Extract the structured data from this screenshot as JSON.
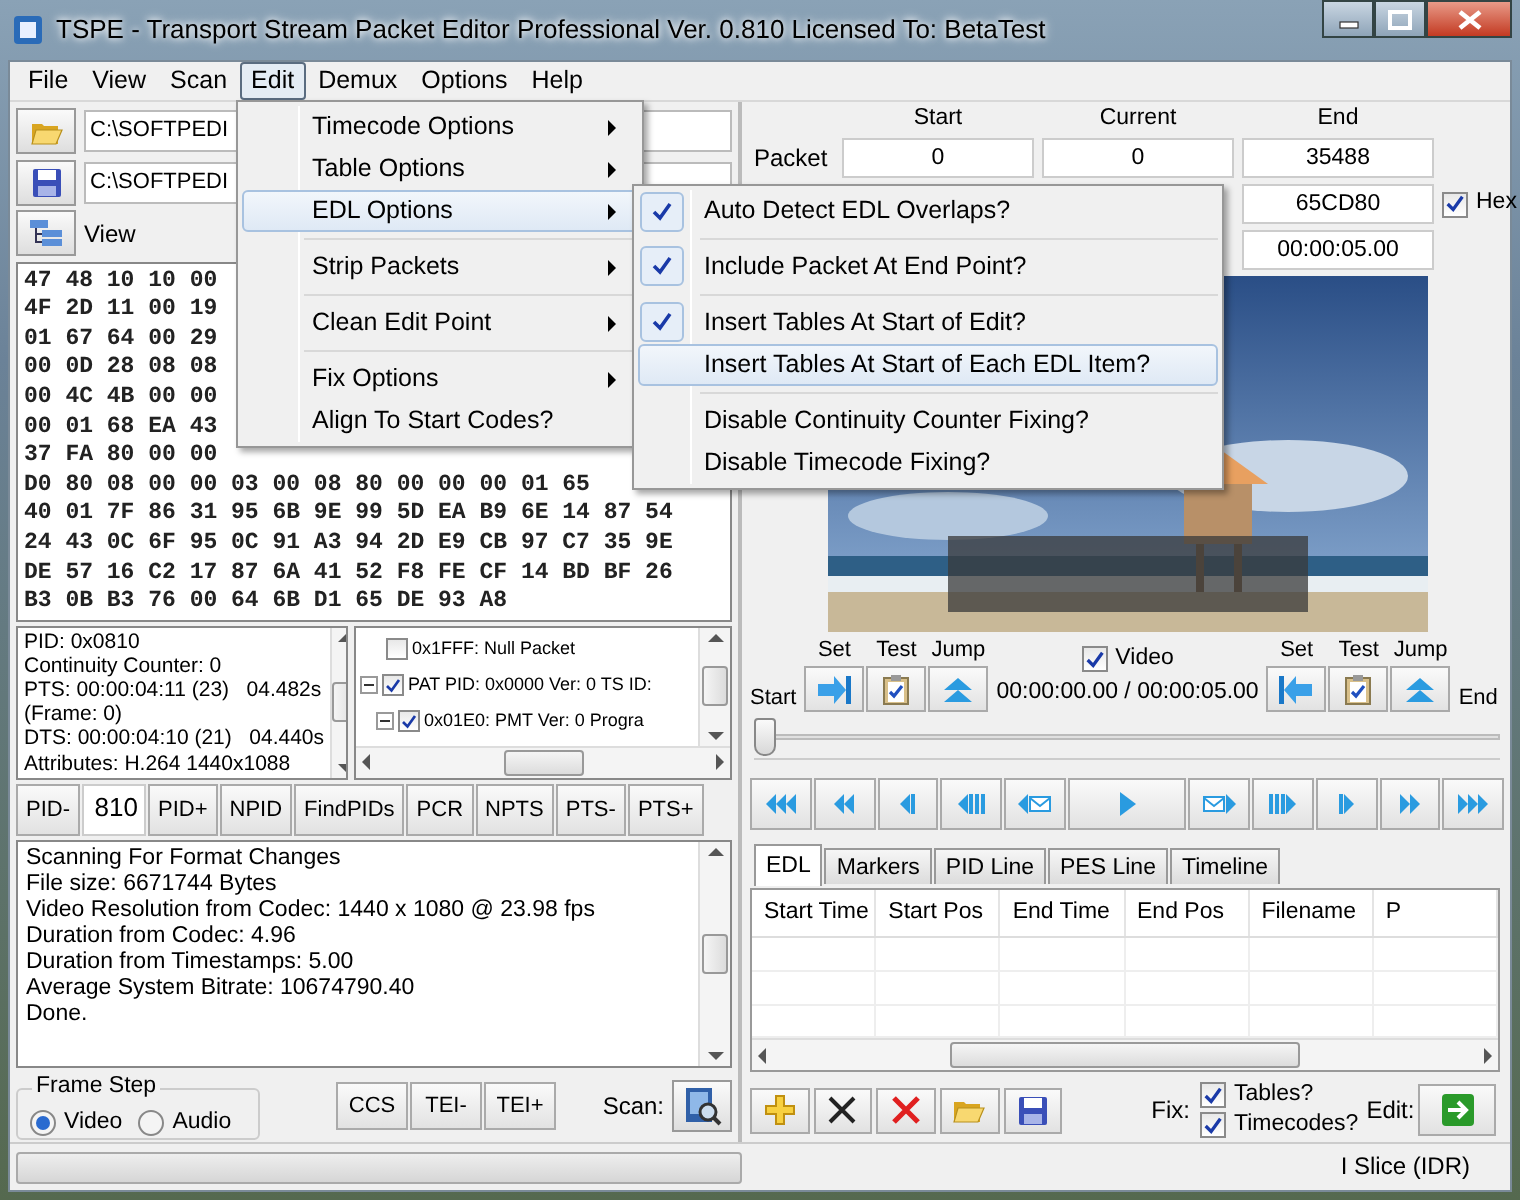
{
  "window": {
    "title": "TSPE - Transport Stream Packet Editor Professional Ver. 0.810 Licensed To: BetaTest"
  },
  "menu_bar": [
    {
      "label": "File",
      "selected": false
    },
    {
      "label": "View",
      "selected": false
    },
    {
      "label": "Scan",
      "selected": false
    },
    {
      "label": "Edit",
      "selected": true
    },
    {
      "label": "Demux",
      "selected": false
    },
    {
      "label": "Options",
      "selected": false
    },
    {
      "label": "Help",
      "selected": false
    }
  ],
  "edit_menu": [
    {
      "label": "Timecode Options",
      "submenu": true,
      "separator_before": false,
      "selected": false
    },
    {
      "label": "Table Options",
      "submenu": true,
      "separator_before": false,
      "selected": false
    },
    {
      "label": "EDL Options",
      "submenu": true,
      "separator_before": false,
      "selected": true
    },
    {
      "label": "Strip Packets",
      "submenu": true,
      "separator_before": true,
      "selected": false
    },
    {
      "label": "Clean Edit Point",
      "submenu": true,
      "separator_before": true,
      "selected": false
    },
    {
      "label": "Fix Options",
      "submenu": true,
      "separator_before": true,
      "selected": false
    },
    {
      "label": "Align To Start Codes?",
      "submenu": false,
      "separator_before": false,
      "selected": false
    }
  ],
  "edl_submenu": [
    {
      "label": "Auto Detect EDL Overlaps?",
      "checked": true,
      "separator_before": false,
      "selected": false
    },
    {
      "label": "Include Packet At End Point?",
      "checked": true,
      "separator_before": true,
      "selected": false
    },
    {
      "label": "Insert Tables At Start of Edit?",
      "checked": true,
      "separator_before": true,
      "selected": false
    },
    {
      "label": "Insert Tables At Start of Each EDL Item?",
      "checked": false,
      "separator_before": false,
      "selected": true
    },
    {
      "label": "Disable Continuity Counter Fixing?",
      "checked": false,
      "separator_before": true,
      "selected": false
    },
    {
      "label": "Disable Timecode Fixing?",
      "checked": false,
      "separator_before": false,
      "selected": false
    }
  ],
  "files": {
    "input_path": "C:\\SOFTPEDI",
    "output_path": "C:\\SOFTPEDI",
    "view_label": "View"
  },
  "hex_rows": [
    "47 48 10 10 00",
    "4F 2D 11 00 19",
    "01 67 64 00 29",
    "00 0D 28 08 08",
    "00 4C 4B 00 00",
    "00 01 68 EA 43",
    "37 FA 80 00 00",
    "D0 80 08 00 00 03 00 08 80 00 00 00 01 65",
    "40 01 7F 86 31 95 6B 9E 99 5D EA B9 6E 14 87 54",
    "24 43 0C 6F 95 0C 91 A3 94 2D E9 CB 97 C7 35 9E",
    "DE 57 16 C2 17 87 6A 41 52 F8 FE CF 14 BD BF 26",
    "B3 0B B3 76 00 64 6B D1 65 DE 93 A8"
  ],
  "packet_info": [
    "PID: 0x0810",
    "Continuity Counter: 0",
    "PTS: 00:00:04:11 (23)   04.482s",
    "(Frame: 0)",
    "DTS: 00:00:04:10 (21)   04.440s",
    "Attributes: H.264 1440x1088"
  ],
  "pid_tree": [
    {
      "label": "0x1FFF: Null Packet",
      "checked": false
    },
    {
      "label": "PAT PID: 0x0000 Ver: 0 TS ID:",
      "checked": true,
      "expanded": true,
      "children": [
        {
          "label": "0x01E0: PMT Ver: 0 Progra",
          "checked": true,
          "expanded": true
        }
      ]
    }
  ],
  "pid_bar": [
    {
      "kind": "button",
      "label": "PID-"
    },
    {
      "kind": "field",
      "value": "810"
    },
    {
      "kind": "button",
      "label": "PID+"
    },
    {
      "kind": "button",
      "label": "NPID"
    },
    {
      "kind": "button",
      "label": "FindPIDs"
    },
    {
      "kind": "button",
      "label": "PCR"
    },
    {
      "kind": "button",
      "label": "NPTS"
    },
    {
      "kind": "button",
      "label": "PTS-"
    },
    {
      "kind": "button",
      "label": "PTS+"
    }
  ],
  "log": [
    "Scanning For Format Changes",
    "File size: 6671744 Bytes",
    "Video Resolution from Codec: 1440 x 1080 @ 23.98 fps",
    "Duration from Codec: 4.96",
    "Duration from Timestamps: 5.00",
    "Average System Bitrate: 10674790.40",
    "Done."
  ],
  "frame_step": {
    "label": "Frame Step",
    "options": [
      {
        "label": "Video",
        "selected": true
      },
      {
        "label": "Audio",
        "selected": false
      }
    ]
  },
  "tool_buttons": [
    "CCS",
    "TEI-",
    "TEI+"
  ],
  "scan_label": "Scan:",
  "progress": {
    "level": 0
  },
  "packet_grid": {
    "columns": [
      "Start",
      "Current",
      "End"
    ],
    "rows": [
      {
        "label": "Packet",
        "start": "0",
        "current": "0",
        "end": "35488"
      },
      {
        "end": "65CD80"
      },
      {
        "end": "00:00:05.00"
      }
    ],
    "hex": {
      "label": "Hex",
      "checked": true
    }
  },
  "markers": {
    "start_label": "Start",
    "end_label": "End",
    "start_buttons": [
      "Set",
      "Test",
      "Jump"
    ],
    "end_buttons": [
      "Set",
      "Test",
      "Jump"
    ],
    "video": {
      "label": "Video",
      "checked": true
    },
    "time": "00:00:00.00 / 00:00:05.00"
  },
  "position_slider": {
    "level": 0
  },
  "tabs": [
    {
      "label": "EDL",
      "selected": true
    },
    {
      "label": "Markers",
      "selected": false
    },
    {
      "label": "PID Line",
      "selected": false
    },
    {
      "label": "PES Line",
      "selected": false
    },
    {
      "label": "Timeline",
      "selected": false
    }
  ],
  "edl_table": {
    "columns": [
      "Start Time",
      "Start Pos",
      "End Time",
      "End Pos",
      "Filename",
      "P"
    ]
  },
  "edl_toolbar": {
    "fix_label": "Fix:",
    "fix_options": [
      {
        "label": "Tables?",
        "checked": true
      },
      {
        "label": "Timecodes?",
        "checked": true
      }
    ],
    "edit_label": "Edit:"
  },
  "status_bar": {
    "text": "I Slice (IDR)"
  }
}
